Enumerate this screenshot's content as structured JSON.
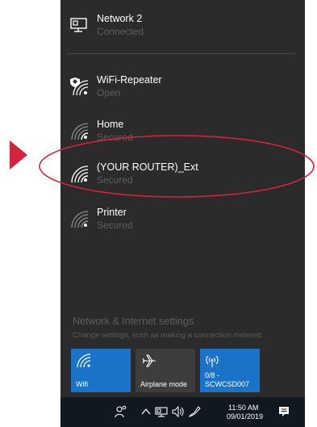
{
  "networks": [
    {
      "name": "Network 2",
      "status": "Connected",
      "icon": "ethernet-icon"
    },
    {
      "name": "WiFi-Repeater",
      "status": "Open",
      "icon": "wifi-shield-icon"
    },
    {
      "name": "Home",
      "status": "Secured",
      "icon": "wifi-icon"
    },
    {
      "name": "(YOUR ROUTER)_Ext",
      "status": "Secured",
      "icon": "wifi-icon"
    },
    {
      "name": "Printer",
      "status": "Secured",
      "icon": "wifi-icon"
    }
  ],
  "settings": {
    "title": "Network & Internet settings",
    "subtitle": "Change settings, such as making a connection metered."
  },
  "quick_actions": [
    {
      "label": "Wifi",
      "active": true,
      "icon": "wifi-icon"
    },
    {
      "label": "Airplane mode",
      "active": false,
      "icon": "airplane-icon"
    },
    {
      "label_line1": "0/8 -",
      "label_line2": "SCWCSD007",
      "active": true,
      "icon": "mobile-hotspot-icon"
    }
  ],
  "taskbar": {
    "time": "11:50 AM",
    "date": "09/01/2019"
  },
  "colors": {
    "flyout_bg": "#2b2b2b",
    "accent": "#1a73c8",
    "tile_inactive": "#3d3d3d",
    "taskbar_bg": "#101820",
    "annotation_red": "#d5233c"
  }
}
